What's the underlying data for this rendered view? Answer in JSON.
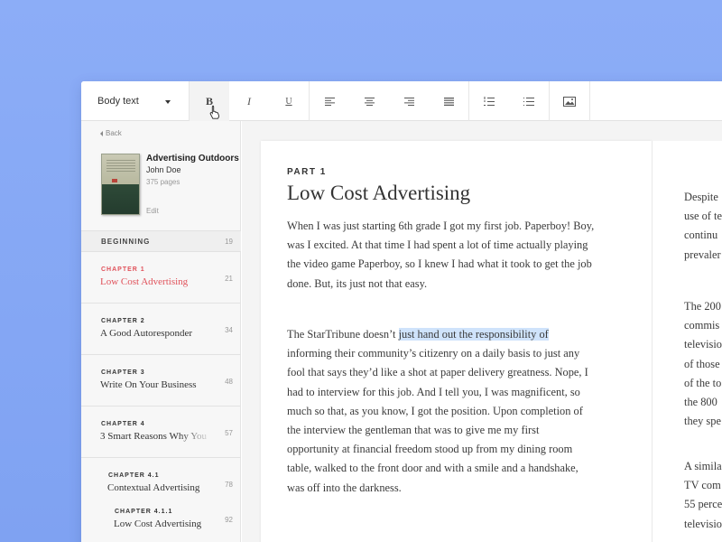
{
  "toolbar": {
    "style_select": "Body text",
    "bold": "B",
    "italic": "I",
    "underline": "U"
  },
  "sidebar": {
    "back": "Back",
    "book": {
      "title": "Advertising Outdoors",
      "author": "John Doe",
      "pages": "375 pages",
      "edit": "Edit"
    },
    "section": {
      "label": "BEGINNING",
      "page": "19"
    },
    "chapters": [
      {
        "label": "CHAPTER 1",
        "title": "Low Cost Advertising",
        "page": "21"
      },
      {
        "label": "CHAPTER 2",
        "title": "A Good Autoresponder",
        "page": "34"
      },
      {
        "label": "CHAPTER 3",
        "title": "Write On Your Business",
        "page": "48"
      },
      {
        "label": "CHAPTER 4",
        "title": "3 Smart Reasons Why You",
        "page": "57"
      },
      {
        "label": "CHAPTER 4.1",
        "title": "Contextual Advertising",
        "page": "78"
      },
      {
        "label": "CHAPTER 4.1.1",
        "title": "Low Cost Advertising",
        "page": "92"
      }
    ]
  },
  "document": {
    "part": "PART 1",
    "heading": "Low Cost Advertising",
    "para1": [
      "When I was just starting 6th grade I got my first job. Paperboy! Boy,",
      "was I excited. At that time I had spent a lot of time actually playing",
      "the video game Paperboy, so I knew I had what it took to get the job",
      "done. But, its just not that easy."
    ],
    "para2_first_pre": "The StarTribune doesn’t ",
    "para2_highlight": "just hand out the responsibility of",
    "para2": [
      "informing their community’s citizenry on a daily basis to just any",
      "fool that says they’d like a shot at paper delivery greatness. Nope, I",
      "had to interview for this job. And I tell you, I was magnificent, so",
      "much so that, as you know, I got the position. Upon completion of",
      "the interview the gentleman that was to give me my first",
      "opportunity at financial freedom stood up from my dining room",
      "table, walked to the front door and with a smile and a handshake,",
      "was off into the darkness."
    ],
    "right_col1": [
      "Despite",
      "use of te",
      "continu",
      "prevaler"
    ],
    "right_col2": [
      "The 200",
      "commis",
      "televisio",
      "of those",
      "of the to",
      "the 800",
      "they spe"
    ],
    "right_col3": [
      "A simila",
      "TV com",
      "55 perce",
      "televisio"
    ]
  }
}
